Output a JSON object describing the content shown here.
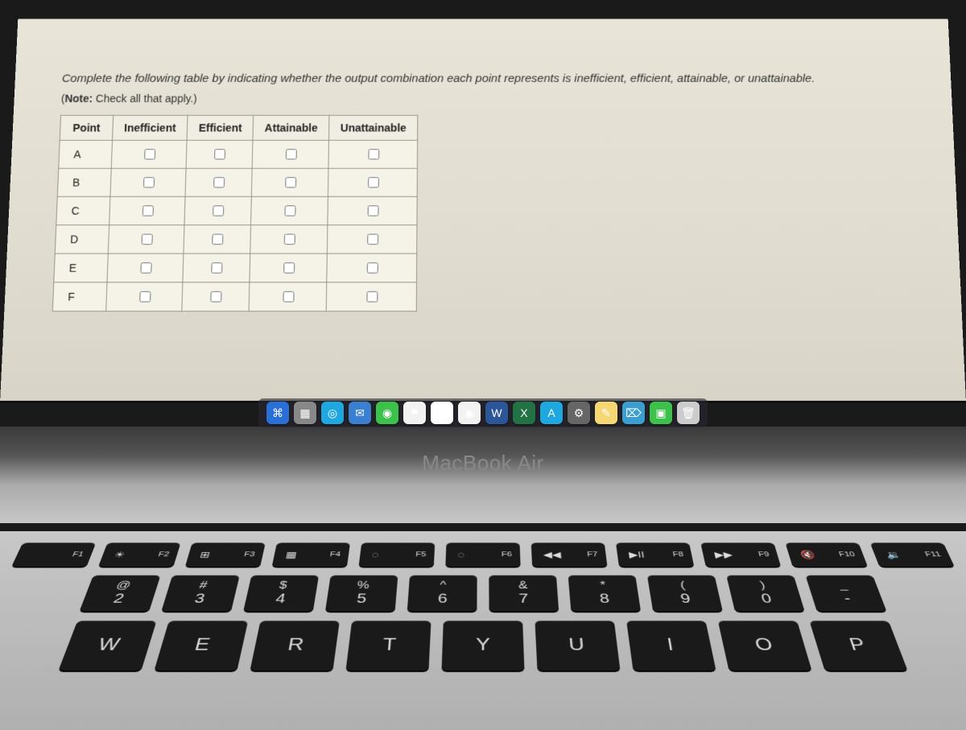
{
  "instruction": "Complete the following table by indicating whether the output combination each point represents is inefficient, efficient, attainable, or unattainable.",
  "note_label": "Note:",
  "note_text": "Check all that apply.)",
  "table": {
    "headers": [
      "Point",
      "Inefficient",
      "Efficient",
      "Attainable",
      "Unattainable"
    ],
    "rows": [
      "A",
      "B",
      "C",
      "D",
      "E",
      "F"
    ]
  },
  "laptop_model": "MacBook Air",
  "dock": [
    {
      "name": "finder",
      "bg": "#2a6fd6",
      "glyph": "⌘"
    },
    {
      "name": "launchpad",
      "bg": "#888",
      "glyph": "▦"
    },
    {
      "name": "safari",
      "bg": "#1fa8e0",
      "glyph": "◎"
    },
    {
      "name": "mail",
      "bg": "#3a7fd0",
      "glyph": "✉"
    },
    {
      "name": "messages",
      "bg": "#3cc24a",
      "glyph": "◉"
    },
    {
      "name": "maps",
      "bg": "#f2f2f2",
      "glyph": "⚑"
    },
    {
      "name": "photos",
      "bg": "#fff",
      "glyph": "✿"
    },
    {
      "name": "chrome",
      "bg": "#f2f2f2",
      "glyph": "◉"
    },
    {
      "name": "word",
      "bg": "#2b579a",
      "glyph": "W"
    },
    {
      "name": "excel",
      "bg": "#217346",
      "glyph": "X"
    },
    {
      "name": "appstore",
      "bg": "#1fa8e0",
      "glyph": "A"
    },
    {
      "name": "settings",
      "bg": "#666",
      "glyph": "⚙"
    },
    {
      "name": "notes",
      "bg": "#f7d774",
      "glyph": "✎"
    },
    {
      "name": "preview",
      "bg": "#3a9fd0",
      "glyph": "⌦"
    },
    {
      "name": "facetime",
      "bg": "#3cc24a",
      "glyph": "▣"
    },
    {
      "name": "trash",
      "bg": "#ccc",
      "glyph": "🗑"
    }
  ],
  "fn_keys": [
    {
      "sym": "",
      "label": "F1"
    },
    {
      "sym": "☀",
      "label": "F2"
    },
    {
      "sym": "⊞",
      "label": "F3"
    },
    {
      "sym": "▦",
      "label": "F4"
    },
    {
      "sym": "◌",
      "label": "F5"
    },
    {
      "sym": "◌",
      "label": "F6"
    },
    {
      "sym": "◀◀",
      "label": "F7"
    },
    {
      "sym": "▶II",
      "label": "F8"
    },
    {
      "sym": "▶▶",
      "label": "F9"
    },
    {
      "sym": "🔇",
      "label": "F10"
    },
    {
      "sym": "🔉",
      "label": "F11"
    }
  ],
  "num_keys": [
    {
      "upper": "@",
      "lower": "2"
    },
    {
      "upper": "#",
      "lower": "3"
    },
    {
      "upper": "$",
      "lower": "4"
    },
    {
      "upper": "%",
      "lower": "5"
    },
    {
      "upper": "^",
      "lower": "6"
    },
    {
      "upper": "&",
      "lower": "7"
    },
    {
      "upper": "*",
      "lower": "8"
    },
    {
      "upper": "(",
      "lower": "9"
    },
    {
      "upper": ")",
      "lower": "0"
    },
    {
      "upper": "_",
      "lower": "-"
    }
  ],
  "letter_keys": [
    "W",
    "E",
    "R",
    "T",
    "Y",
    "U",
    "I",
    "O",
    "P"
  ]
}
